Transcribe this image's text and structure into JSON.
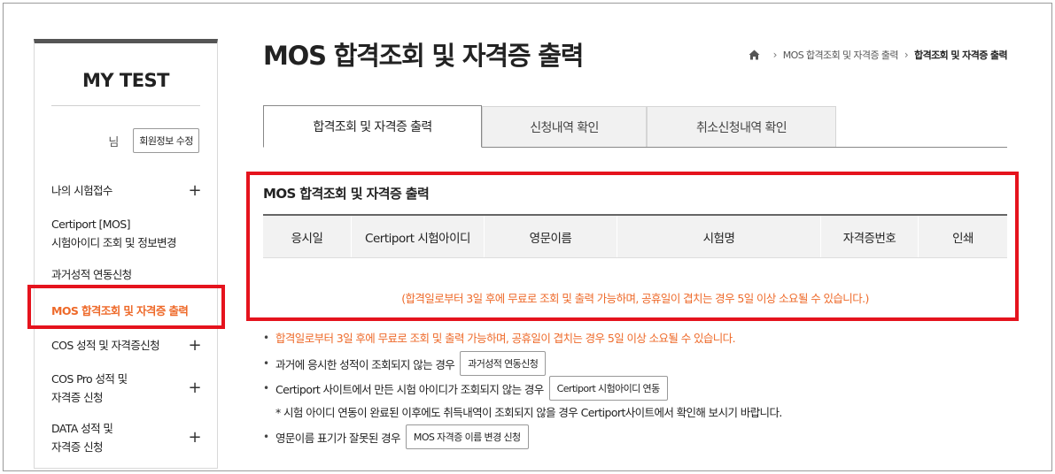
{
  "sidebar": {
    "title": "MY TEST",
    "user_suffix": "님",
    "edit_profile_label": "회원정보 수정",
    "items": [
      {
        "label": "나의 시험접수",
        "plus": "+"
      },
      {
        "label_line1": "Certiport [MOS]",
        "label_line2": "시험아이디 조회 및 정보변경"
      },
      {
        "label": "과거성적 연동신청"
      },
      {
        "label": "MOS 합격조회 및 자격증 출력",
        "active": true
      },
      {
        "label": "COS 성적 및 자격증신청",
        "plus": "+"
      },
      {
        "label_line1": "COS Pro 성적 및",
        "label_line2": "자격증 신청",
        "plus": "+"
      },
      {
        "label_line1": "DATA 성적 및",
        "label_line2": "자격증 신청",
        "plus": "+"
      }
    ]
  },
  "header": {
    "title": "MOS 합격조회 및 자격증 출력",
    "breadcrumb": [
      "MOS 합격조회 및 자격증 출력",
      "합격조회 및 자격증 출력"
    ]
  },
  "tabs": [
    {
      "label": "합격조회 및 자격증 출력",
      "active": true
    },
    {
      "label": "신청내역 확인",
      "active": false
    },
    {
      "label": "취소신청내역 확인",
      "active": false
    }
  ],
  "result": {
    "section_title": "MOS 합격조회 및 자격증 출력",
    "columns": [
      "응시일",
      "Certiport 시험아이디",
      "영문이름",
      "시험명",
      "자격증번호",
      "인쇄"
    ],
    "empty_notice": "(합격일로부터 3일 후에 무료로 조회 및 출력 가능하며, 공휴일이 겹치는 경우 5일 이상 소요될 수 있습니다.)"
  },
  "notes": [
    {
      "text": "합격일로부터 3일 후에 무료로 조회 및 출력 가능하며, 공휴일이 겹치는 경우 5일 이상 소요될 수 있습니다."
    },
    {
      "text": "과거에 응시한 성적이 조회되지 않는 경우",
      "button": "과거성적 연동신청"
    },
    {
      "text": "Certiport 사이트에서 만든 시험 아이디가 조회되지 않는 경우",
      "button": "Certiport 시험아이디 연동"
    },
    {
      "text": "* 시험 아이디 연동이 완료된 이후에도 취득내역이 조회되지 않을 경우 Certiport사이트에서 확인해 보시기 바랍니다."
    },
    {
      "text": "영문이름 표기가 잘못된 경우",
      "button": "MOS 자격증 이름 변경 신청"
    }
  ],
  "colors": {
    "accent": "#ee6a2a",
    "highlight_red": "#e5131d"
  },
  "icons": {
    "home": "home-icon",
    "breadcrumb_separator": "›",
    "menu_expand": "plus-icon"
  }
}
